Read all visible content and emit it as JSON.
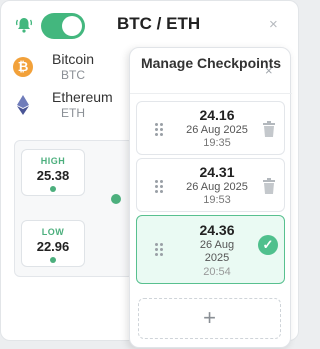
{
  "header": {
    "title": "BTC / ETH",
    "close_label": "×",
    "alert_toggle": "on"
  },
  "coins": [
    {
      "name": "Bitcoin",
      "symbol": "BTC",
      "icon": "bitcoin-icon",
      "icon_glyph": "₿",
      "color": "#f2a13a"
    },
    {
      "name": "Ethereum",
      "symbol": "ETH",
      "icon": "ethereum-icon",
      "color": "#6f7cba"
    }
  ],
  "range": {
    "high_label": "HIGH",
    "high_value": "25.38",
    "low_label": "LOW",
    "low_value": "22.96"
  },
  "panel": {
    "title": "Manage Checkpoints",
    "close_label": "×",
    "add_label": "+",
    "checkpoints": [
      {
        "value": "24.16",
        "date": "26 Aug 2025",
        "time": "19:35",
        "active": false
      },
      {
        "value": "24.31",
        "date": "26 Aug 2025",
        "time": "19:53",
        "active": false
      },
      {
        "value": "24.36",
        "date_line1": "26 Aug",
        "date_line2": "2025",
        "time": "20:54",
        "active": true
      }
    ]
  },
  "colors": {
    "accent": "#43b77e",
    "active_bg": "#eafaf3",
    "bitcoin": "#f2a13a"
  }
}
